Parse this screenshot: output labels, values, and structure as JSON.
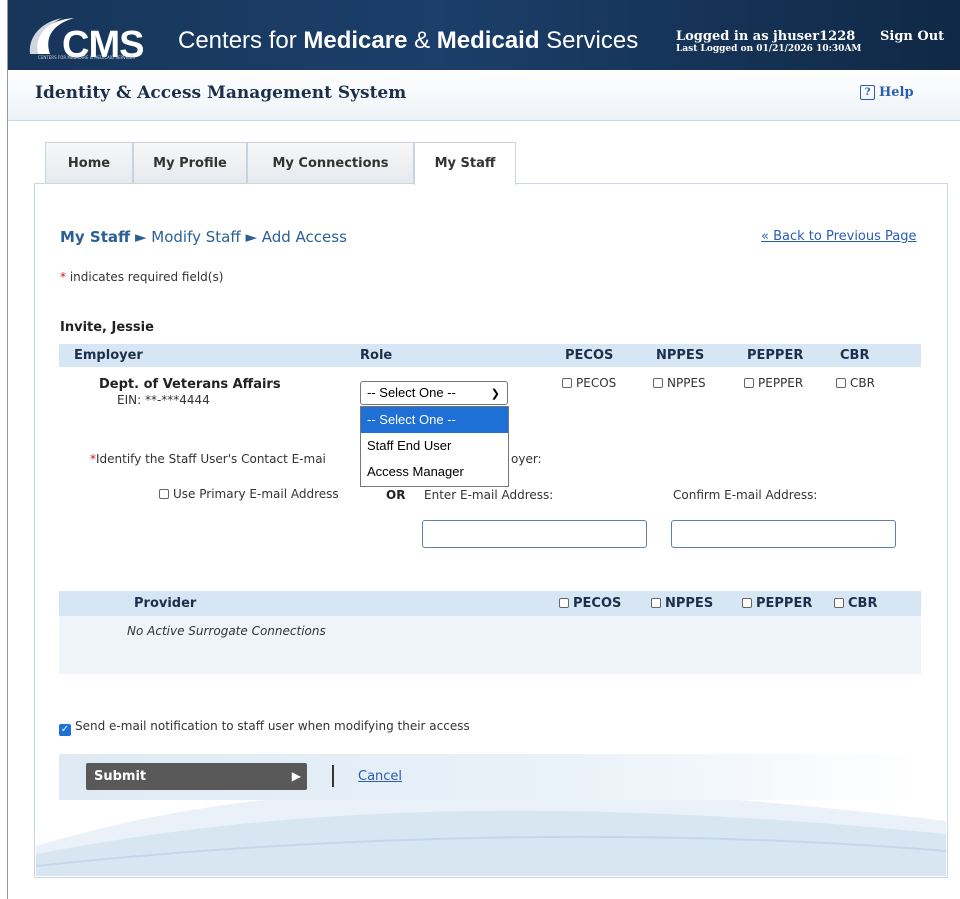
{
  "header": {
    "logo_text": "CMS",
    "logo_subtext": "CENTERS FOR MEDICARE & MEDICAID SERVICES",
    "agency_part1": "Centers for ",
    "agency_medicare": "Medicare",
    "agency_amp": " & ",
    "agency_medicaid": "Medicaid",
    "agency_part2": " Services",
    "logged_in": "Logged in as jhuser1228",
    "last_logged": "Last Logged on 01/21/2026 10:30AM",
    "sign_out": "Sign Out"
  },
  "system": {
    "title": "Identity & Access Management System",
    "help_icon": "?",
    "help": "Help"
  },
  "tabs": [
    {
      "label": "Home"
    },
    {
      "label": "My Profile"
    },
    {
      "label": "My Connections"
    },
    {
      "label": "My Staff"
    }
  ],
  "breadcrumb": {
    "root": "My Staff",
    "sep": " ► ",
    "mid": "Modify Staff",
    "leaf": "Add Access"
  },
  "back_link": "« Back to Previous Page",
  "required_note": " indicates required field(s)",
  "required_star": "*",
  "staff_name": "Invite, Jessie",
  "table": {
    "headers": {
      "employer": "Employer",
      "role": "Role",
      "pecos": "PECOS",
      "nppes": "NPPES",
      "pepper": "PEPPER",
      "cbr": "CBR"
    },
    "employer_name": "Dept. of Veterans Affairs",
    "ein": "EIN: **-***4444",
    "role_select": {
      "value": "-- Select One --",
      "options": [
        "-- Select One --",
        "Staff End User",
        "Access Manager"
      ]
    },
    "checks": {
      "pecos": "PECOS",
      "nppes": "NPPES",
      "pepper": "PEPPER",
      "cbr": "CBR"
    }
  },
  "email": {
    "identify_prefix": "Identify the Staff User's Contact E-mai",
    "identify_suffix": "oyer:",
    "use_primary": "Use Primary E-mail Address",
    "or": "OR",
    "enter_label": "Enter E-mail Address:",
    "confirm_label": "Confirm E-mail Address:",
    "enter_value": "",
    "confirm_value": ""
  },
  "provider": {
    "header": "Provider",
    "checks": {
      "pecos": "PECOS",
      "nppes": "NPPES",
      "pepper": "PEPPER",
      "cbr": "CBR"
    },
    "empty": "No Active Surrogate Connections"
  },
  "notify": {
    "checked": true,
    "label": "Send e-mail notification to staff user when modifying their access"
  },
  "actions": {
    "submit": "Submit",
    "cancel": "Cancel"
  },
  "colors": {
    "header_bg": "#173559",
    "link": "#2a5db0",
    "table_header": "#d6e6f4",
    "dropdown_highlight": "#1e6fd6",
    "required": "#d6111c"
  }
}
